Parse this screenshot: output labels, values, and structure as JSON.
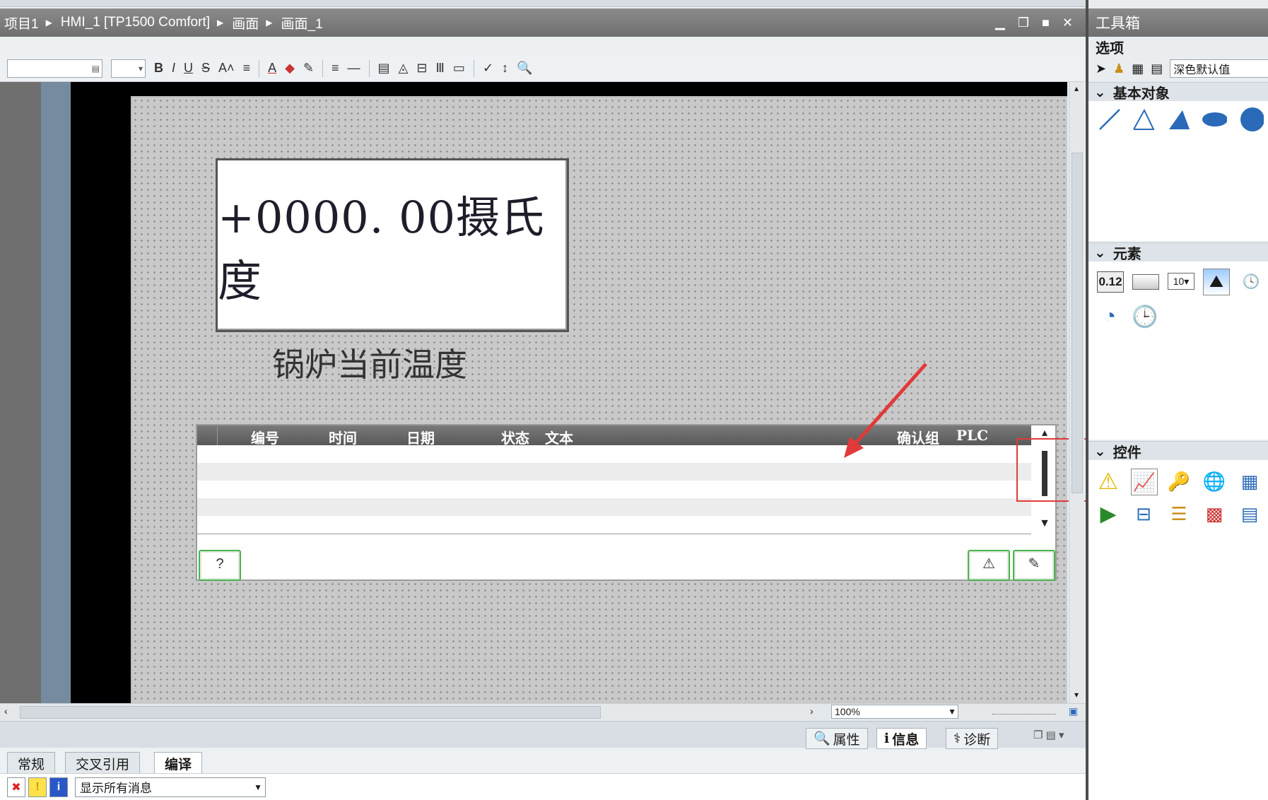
{
  "breadcrumb": [
    "项目1",
    "HMI_1 [TP1500 Comfort]",
    "画面",
    "画面_1"
  ],
  "window_controls": [
    "▁",
    "❐",
    "■",
    "✕"
  ],
  "format_toolbar": {
    "font_box": "",
    "size_box": "",
    "buttons": [
      "B",
      "I",
      "U",
      "S",
      "A˄",
      "≡",
      "A",
      "◆",
      "✎",
      "≡",
      "—",
      "▤",
      "◬",
      "⊟",
      "Ⅲ",
      "▭",
      "✓",
      "↕",
      "🔍"
    ]
  },
  "screen": {
    "io_field_value": "+0000. 00摄氏度",
    "temp_label": "锅炉当前温度"
  },
  "alarm_view": {
    "columns": [
      "编号",
      "时间",
      "日期",
      "状态",
      "文本",
      "确认组",
      "PLC"
    ],
    "row_count": 5,
    "buttons": {
      "help": "?",
      "acknowledge": "⚠",
      "edit": "✎"
    }
  },
  "zoom": "100%",
  "inspector_tabs": [
    "属性",
    "信息",
    "诊断"
  ],
  "sub_tabs": [
    "常规",
    "交叉引用",
    "编译"
  ],
  "active_sub_tab": "编译",
  "message_filter": "显示所有消息",
  "toolbox": {
    "title": "工具箱",
    "options_label": "选项",
    "style_value": "深色默认值",
    "panes": [
      {
        "name": "基本对象",
        "icons": [
          "line-icon",
          "polyline-icon",
          "polygon-icon",
          "ellipse-icon",
          "circle-icon"
        ]
      },
      {
        "name": "元素",
        "icons": [
          "io-field-icon",
          "button-icon",
          "symbolic-io-icon",
          "graphic-view-icon",
          "date-time-icon",
          "gauge-icon",
          "clock-icon"
        ]
      },
      {
        "name": "控件",
        "icons": [
          "alarm-view-icon",
          "trend-view-icon",
          "user-view-icon",
          "html-browser-icon",
          "recipe-view-icon",
          "media-player-icon",
          "plc-code-viewer-icon",
          "system-diagnostics-icon",
          "status-force-icon",
          "sm-table-icon"
        ]
      }
    ]
  },
  "colors": {
    "title_bar": "#7d7d7d",
    "screen_background": "#c9c9c9",
    "alarm_header": "#666666",
    "highlight_box": "#e03a3a",
    "button_border": "#4cb34c"
  }
}
